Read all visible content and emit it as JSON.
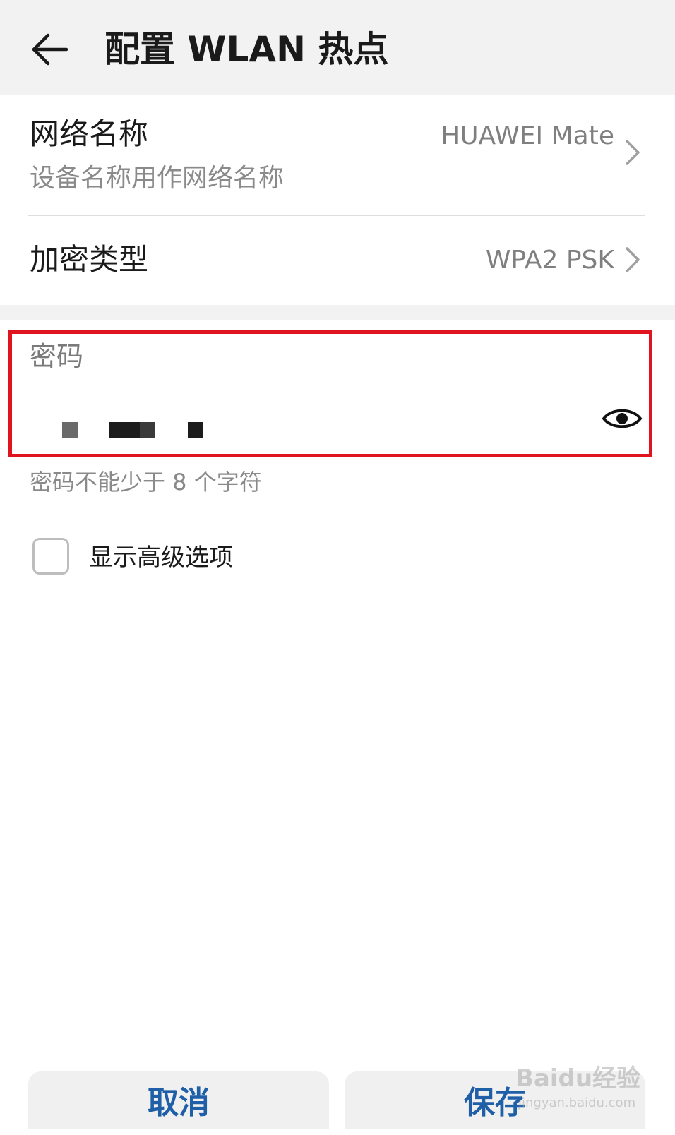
{
  "header": {
    "title": "配置 WLAN 热点"
  },
  "network_name": {
    "title": "网络名称",
    "subtitle": "设备名称用作网络名称",
    "value": "HUAWEI Mate"
  },
  "encryption": {
    "title": "加密类型",
    "value": "WPA2 PSK"
  },
  "password": {
    "label": "密码",
    "value": "",
    "hint": "密码不能少于 8 个字符"
  },
  "advanced": {
    "label": "显示高级选项",
    "checked": false
  },
  "buttons": {
    "cancel": "取消",
    "save": "保存"
  },
  "watermark": {
    "brand": "Baidu经验",
    "url": "jingyan.baidu.com"
  },
  "colors": {
    "accent_button_text": "#1f5fa8",
    "highlight_border": "#e0141e",
    "header_bg": "#f2f2f2"
  }
}
